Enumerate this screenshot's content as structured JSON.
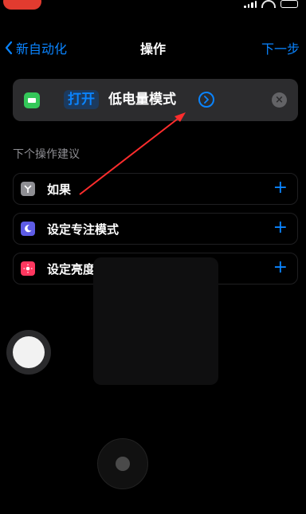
{
  "nav": {
    "back_label": "新自动化",
    "title": "操作",
    "next_label": "下一步"
  },
  "action": {
    "verb": "打开",
    "parameter": "低电量模式",
    "icon": "battery-icon",
    "icon_color": "#34c759"
  },
  "suggestions": {
    "section_title": "下个操作建议",
    "items": [
      {
        "label": "如果",
        "icon": "branch-icon",
        "color": "#8e8e93",
        "add": "+"
      },
      {
        "label": "设定专注模式",
        "icon": "moon-icon",
        "color": "#5e5ce6",
        "add": "+"
      },
      {
        "label": "设定亮度",
        "icon": "sun-icon",
        "color": "#ff375f",
        "add": "+"
      }
    ]
  },
  "colors": {
    "accent": "#0a84ff",
    "annotation_arrow": "#ff2d2d"
  }
}
